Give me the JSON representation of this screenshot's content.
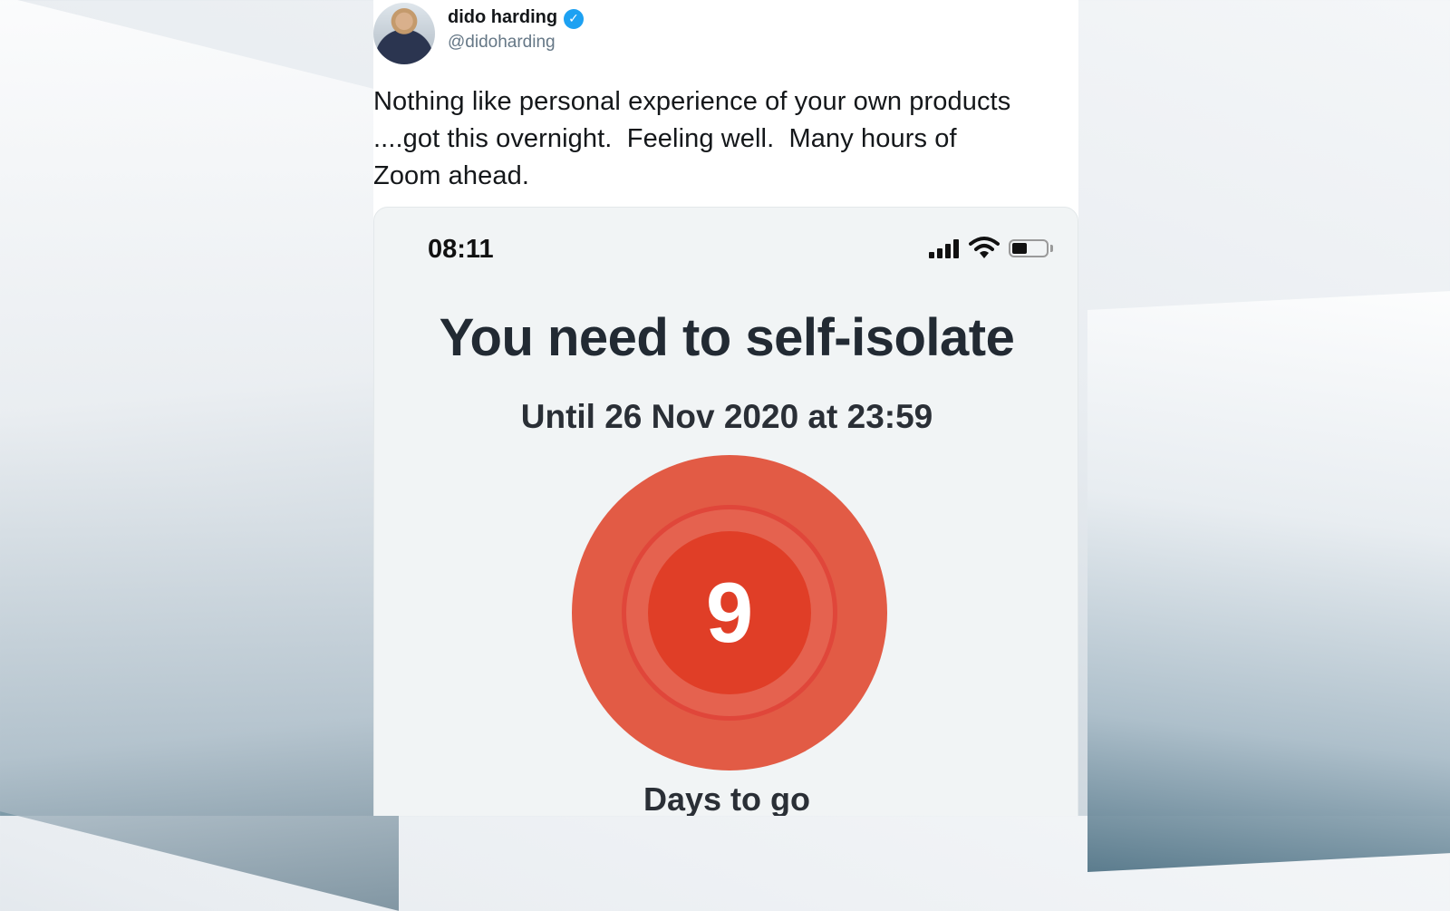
{
  "tweet": {
    "name": "dido harding",
    "handle": "@didoharding",
    "verified_icon": "verified-badge-icon",
    "text": "Nothing like personal experience of your own products\n....got this overnight.  Feeling well.  Many hours of\nZoom ahead."
  },
  "phone": {
    "status": {
      "time": "08:11",
      "icons": [
        "signal-icon",
        "wifi-icon",
        "battery-icon"
      ]
    },
    "headline": "You need to self-isolate",
    "until": "Until 26 Nov 2020 at 23:59",
    "days_count": "9",
    "days_label": "Days to go"
  },
  "colors": {
    "accent_red": "#e03e27",
    "outer_red": "#e25b45",
    "verified_blue": "#1da1f2"
  }
}
